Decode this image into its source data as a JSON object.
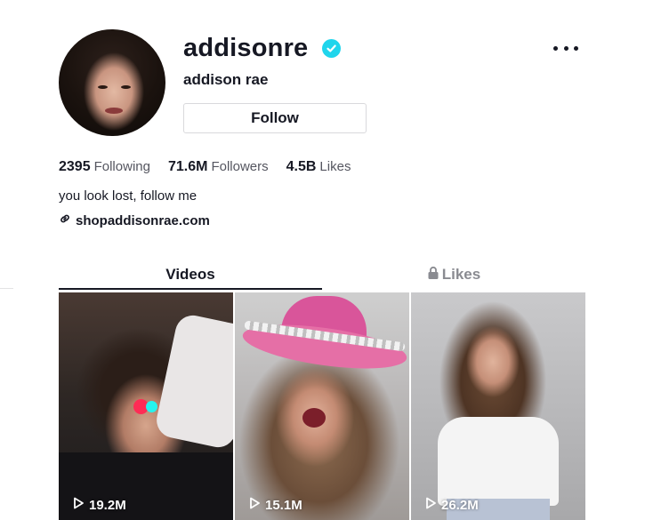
{
  "profile": {
    "username": "addisonre",
    "display_name": "addison rae",
    "follow_label": "Follow",
    "verified": true,
    "bio": "you look lost, follow me",
    "link": "shopaddisonrae.com"
  },
  "stats": [
    {
      "value": "2395",
      "label": "Following"
    },
    {
      "value": "71.6M",
      "label": "Followers"
    },
    {
      "value": "4.5B",
      "label": "Likes"
    }
  ],
  "tabs": [
    {
      "label": "Videos",
      "active": true
    },
    {
      "label": "Likes",
      "locked": true
    }
  ],
  "videos": [
    {
      "views": "19.2M"
    },
    {
      "views": "15.1M"
    },
    {
      "views": "26.2M"
    }
  ],
  "colors": {
    "verified": "#20d5ec",
    "brand_red": "#fe2c55",
    "brand_cyan": "#25f4ee",
    "text": "#161823",
    "muted": "#8a8b91"
  },
  "icons": {
    "verified": "verified-check-icon",
    "more": "more-horizontal-icon",
    "link": "link-icon",
    "lock": "lock-icon",
    "play": "play-icon"
  }
}
